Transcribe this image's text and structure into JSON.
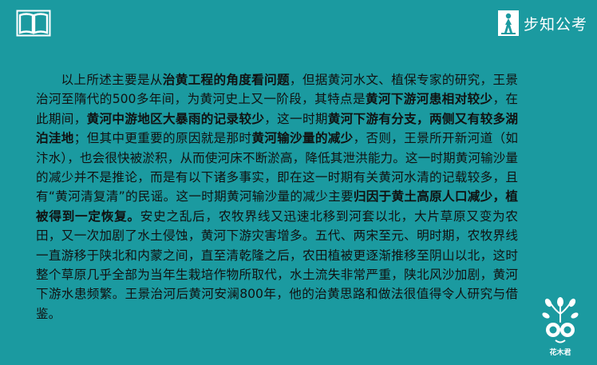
{
  "brand": {
    "name": "步知公考"
  },
  "mascot": {
    "label": "花木君"
  },
  "paragraph": {
    "s1": "以上所述主要是从",
    "b1": "治黄工程的角度看问题",
    "s2": "，但据黄河水文、植保专家的研究，王景治河至隋代的500多年间，为黄河史上又一阶段，其特点是",
    "b2": "黄河下游河患相对较少",
    "s3": "，在此期间，",
    "b3": "黄河中游地区大暴雨的记录较少",
    "s4": "，这一时期",
    "b4": "黄河下游有分支，两侧又有较多湖泊洼地",
    "s5": "；但其中更重要的原因就是那时",
    "b5": "黄河输沙量的减少",
    "s6": "，否则，王景所开新河道（如汴水），也会很快被淤积，从而使河床不断淤高，降低其泄洪能力。这一时期黄河输沙量的减少并不是推论，而是有以下诸多事实，即在这一时期有关黄河水清的记载较多，且有“黄河清复清”的民谣。这一时期黄河输沙量的减少主要",
    "b6": "归因于黄土高原人口减少，植被得到一定恢复。",
    "s7": "安史之乱后，农牧界线又迅速北移到河套以北，大片草原又变为农田，又一次加剧了水土侵蚀，黄河下游灾害增多。五代、两宋至元、明时期，农牧界线一直游移于陕北和内蒙之间，直至清乾隆之后，农田植被更逐渐推移至阴山以北，这时整个草原几乎全部为当年生栽培作物所取代，水土流失非常严重，陕北风沙加剧，黄河下游水患频繁。王景治河后黄河安澜800年，他的治黄思路和做法很值得令人研究与借鉴。"
  }
}
